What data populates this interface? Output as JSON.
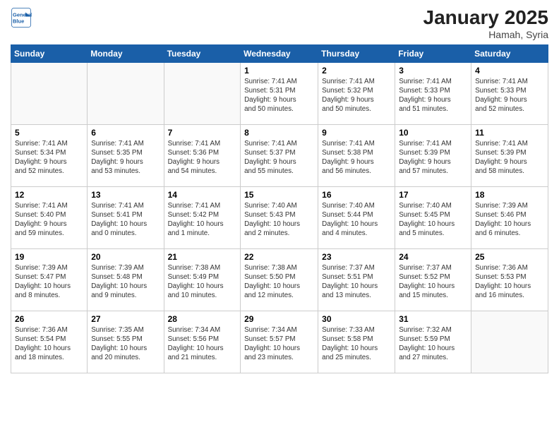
{
  "header": {
    "logo_line1": "General",
    "logo_line2": "Blue",
    "month": "January 2025",
    "location": "Hamah, Syria"
  },
  "days_of_week": [
    "Sunday",
    "Monday",
    "Tuesday",
    "Wednesday",
    "Thursday",
    "Friday",
    "Saturday"
  ],
  "weeks": [
    [
      {
        "day": "",
        "text": ""
      },
      {
        "day": "",
        "text": ""
      },
      {
        "day": "",
        "text": ""
      },
      {
        "day": "1",
        "text": "Sunrise: 7:41 AM\nSunset: 5:31 PM\nDaylight: 9 hours\nand 50 minutes."
      },
      {
        "day": "2",
        "text": "Sunrise: 7:41 AM\nSunset: 5:32 PM\nDaylight: 9 hours\nand 50 minutes."
      },
      {
        "day": "3",
        "text": "Sunrise: 7:41 AM\nSunset: 5:33 PM\nDaylight: 9 hours\nand 51 minutes."
      },
      {
        "day": "4",
        "text": "Sunrise: 7:41 AM\nSunset: 5:33 PM\nDaylight: 9 hours\nand 52 minutes."
      }
    ],
    [
      {
        "day": "5",
        "text": "Sunrise: 7:41 AM\nSunset: 5:34 PM\nDaylight: 9 hours\nand 52 minutes."
      },
      {
        "day": "6",
        "text": "Sunrise: 7:41 AM\nSunset: 5:35 PM\nDaylight: 9 hours\nand 53 minutes."
      },
      {
        "day": "7",
        "text": "Sunrise: 7:41 AM\nSunset: 5:36 PM\nDaylight: 9 hours\nand 54 minutes."
      },
      {
        "day": "8",
        "text": "Sunrise: 7:41 AM\nSunset: 5:37 PM\nDaylight: 9 hours\nand 55 minutes."
      },
      {
        "day": "9",
        "text": "Sunrise: 7:41 AM\nSunset: 5:38 PM\nDaylight: 9 hours\nand 56 minutes."
      },
      {
        "day": "10",
        "text": "Sunrise: 7:41 AM\nSunset: 5:39 PM\nDaylight: 9 hours\nand 57 minutes."
      },
      {
        "day": "11",
        "text": "Sunrise: 7:41 AM\nSunset: 5:39 PM\nDaylight: 9 hours\nand 58 minutes."
      }
    ],
    [
      {
        "day": "12",
        "text": "Sunrise: 7:41 AM\nSunset: 5:40 PM\nDaylight: 9 hours\nand 59 minutes."
      },
      {
        "day": "13",
        "text": "Sunrise: 7:41 AM\nSunset: 5:41 PM\nDaylight: 10 hours\nand 0 minutes."
      },
      {
        "day": "14",
        "text": "Sunrise: 7:41 AM\nSunset: 5:42 PM\nDaylight: 10 hours\nand 1 minute."
      },
      {
        "day": "15",
        "text": "Sunrise: 7:40 AM\nSunset: 5:43 PM\nDaylight: 10 hours\nand 2 minutes."
      },
      {
        "day": "16",
        "text": "Sunrise: 7:40 AM\nSunset: 5:44 PM\nDaylight: 10 hours\nand 4 minutes."
      },
      {
        "day": "17",
        "text": "Sunrise: 7:40 AM\nSunset: 5:45 PM\nDaylight: 10 hours\nand 5 minutes."
      },
      {
        "day": "18",
        "text": "Sunrise: 7:39 AM\nSunset: 5:46 PM\nDaylight: 10 hours\nand 6 minutes."
      }
    ],
    [
      {
        "day": "19",
        "text": "Sunrise: 7:39 AM\nSunset: 5:47 PM\nDaylight: 10 hours\nand 8 minutes."
      },
      {
        "day": "20",
        "text": "Sunrise: 7:39 AM\nSunset: 5:48 PM\nDaylight: 10 hours\nand 9 minutes."
      },
      {
        "day": "21",
        "text": "Sunrise: 7:38 AM\nSunset: 5:49 PM\nDaylight: 10 hours\nand 10 minutes."
      },
      {
        "day": "22",
        "text": "Sunrise: 7:38 AM\nSunset: 5:50 PM\nDaylight: 10 hours\nand 12 minutes."
      },
      {
        "day": "23",
        "text": "Sunrise: 7:37 AM\nSunset: 5:51 PM\nDaylight: 10 hours\nand 13 minutes."
      },
      {
        "day": "24",
        "text": "Sunrise: 7:37 AM\nSunset: 5:52 PM\nDaylight: 10 hours\nand 15 minutes."
      },
      {
        "day": "25",
        "text": "Sunrise: 7:36 AM\nSunset: 5:53 PM\nDaylight: 10 hours\nand 16 minutes."
      }
    ],
    [
      {
        "day": "26",
        "text": "Sunrise: 7:36 AM\nSunset: 5:54 PM\nDaylight: 10 hours\nand 18 minutes."
      },
      {
        "day": "27",
        "text": "Sunrise: 7:35 AM\nSunset: 5:55 PM\nDaylight: 10 hours\nand 20 minutes."
      },
      {
        "day": "28",
        "text": "Sunrise: 7:34 AM\nSunset: 5:56 PM\nDaylight: 10 hours\nand 21 minutes."
      },
      {
        "day": "29",
        "text": "Sunrise: 7:34 AM\nSunset: 5:57 PM\nDaylight: 10 hours\nand 23 minutes."
      },
      {
        "day": "30",
        "text": "Sunrise: 7:33 AM\nSunset: 5:58 PM\nDaylight: 10 hours\nand 25 minutes."
      },
      {
        "day": "31",
        "text": "Sunrise: 7:32 AM\nSunset: 5:59 PM\nDaylight: 10 hours\nand 27 minutes."
      },
      {
        "day": "",
        "text": ""
      }
    ]
  ]
}
